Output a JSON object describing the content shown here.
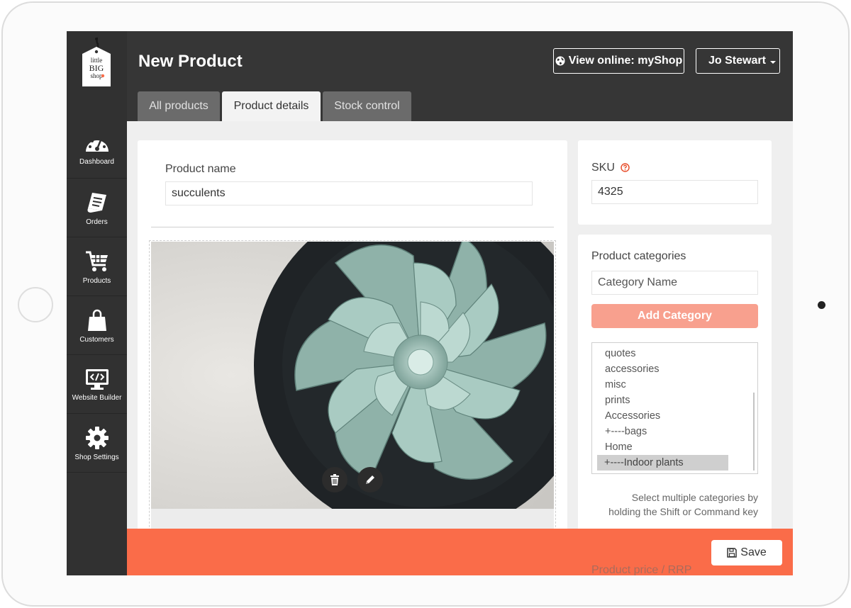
{
  "app": {
    "logo_text": [
      "little",
      "BIG",
      "shop"
    ]
  },
  "sidebar": {
    "items": [
      {
        "label": "Dashboard",
        "icon": "dashboard-gauge-icon"
      },
      {
        "label": "Orders",
        "icon": "orders-receipt-icon"
      },
      {
        "label": "Products",
        "icon": "shopping-cart-icon"
      },
      {
        "label": "Customers",
        "icon": "shopping-bag-icon"
      },
      {
        "label": "Website Builder",
        "icon": "monitor-code-icon"
      },
      {
        "label": "Shop Settings",
        "icon": "gear-icon"
      }
    ]
  },
  "header": {
    "title": "New Product",
    "view_online_label": "View online: myShop",
    "user_name": "Jo Stewart"
  },
  "tabs": [
    {
      "label": "All products",
      "active": false
    },
    {
      "label": "Product details",
      "active": true
    },
    {
      "label": "Stock control",
      "active": false
    }
  ],
  "product": {
    "name_label": "Product name",
    "name_value": "succulents",
    "image_alt": "succulent plant photo",
    "delete_icon": "trash-icon",
    "edit_icon": "pencil-icon"
  },
  "sku": {
    "label": "SKU",
    "value": "4325"
  },
  "categories": {
    "label": "Product categories",
    "input_placeholder": "Category Name",
    "add_label": "Add Category",
    "options": [
      "quotes",
      "accessories",
      "misc",
      "prints",
      "Accessories",
      "+----bags",
      "Home",
      "+----Indoor plants"
    ],
    "selected": "+----Indoor plants",
    "hint_line1": "Select multiple categories by",
    "hint_line2": "holding the Shift or Command key"
  },
  "price": {
    "label": "Product price / RRP"
  },
  "save_bar": {
    "save_label": "Save"
  },
  "colors": {
    "accent": "#fa6c49",
    "add_button": "#f8a08e",
    "sidebar": "#313131",
    "header": "#363636"
  }
}
